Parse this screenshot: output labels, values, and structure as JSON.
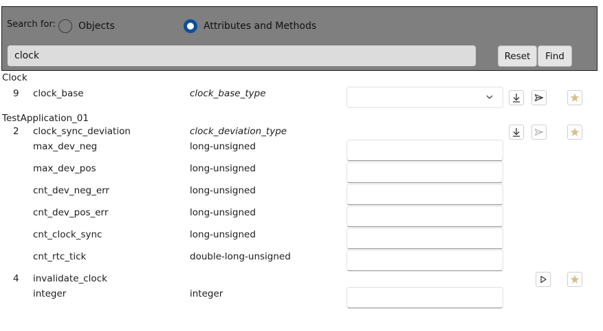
{
  "search": {
    "label": "Search for:",
    "options": [
      {
        "label": "Objects",
        "selected": false
      },
      {
        "label": "Attributes and Methods",
        "selected": true
      }
    ],
    "query": "clock",
    "reset_label": "Reset",
    "find_label": "Find"
  },
  "colors": {
    "panel": "#7f7f7f",
    "radio_selected": "#0a4f9c",
    "star": "#d8c08e"
  },
  "groups": [
    {
      "name": "Clock",
      "entries": [
        {
          "index": "9",
          "name": "clock_base",
          "type": "clock_base_type",
          "value": "",
          "control": "dropdown",
          "actions": [
            "download-icon",
            "send-icon",
            "star-icon"
          ]
        }
      ]
    },
    {
      "name": "TestApplication_01",
      "entries": [
        {
          "index": "2",
          "name": "clock_sync_deviation",
          "type": "clock_deviation_type",
          "actions": [
            "download-icon",
            "send-icon (disabled)",
            "star-icon"
          ],
          "fields": [
            {
              "name": "max_dev_neg",
              "type": "long-unsigned",
              "value": ""
            },
            {
              "name": "max_dev_pos",
              "type": "long-unsigned",
              "value": ""
            },
            {
              "name": "cnt_dev_neg_err",
              "type": "long-unsigned",
              "value": ""
            },
            {
              "name": "cnt_dev_pos_err",
              "type": "long-unsigned",
              "value": ""
            },
            {
              "name": "cnt_clock_sync",
              "type": "long-unsigned",
              "value": ""
            },
            {
              "name": "cnt_rtc_tick",
              "type": "double-long-unsigned",
              "value": ""
            }
          ]
        },
        {
          "index": "4",
          "name": "invalidate_clock",
          "type": "",
          "actions": [
            "play-icon",
            "star-icon"
          ],
          "fields": [
            {
              "name": "integer",
              "type": "integer",
              "value": ""
            }
          ]
        }
      ]
    }
  ]
}
